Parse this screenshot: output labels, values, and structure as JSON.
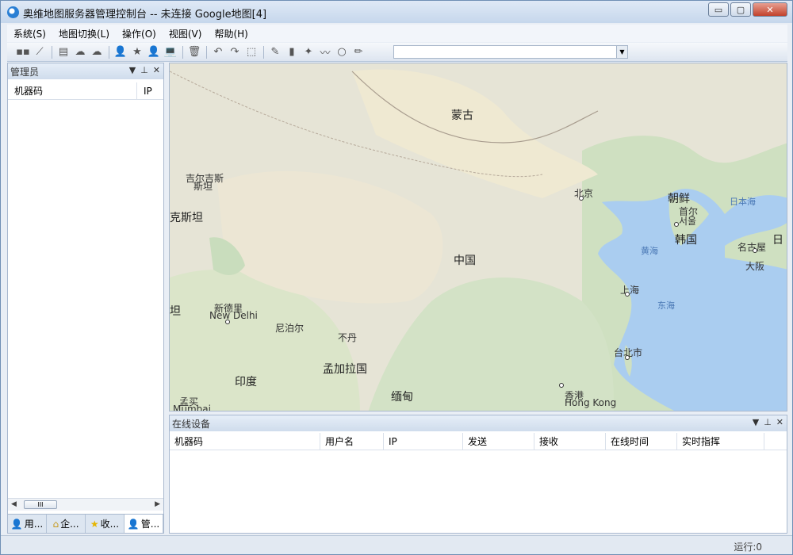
{
  "window": {
    "title": "奥维地图服务器管理控制台 -- 未连接  Google地图[4]",
    "minimize_label": "▭",
    "maximize_label": "▢",
    "close_label": "✕"
  },
  "menu": [
    {
      "label": "系统(S)"
    },
    {
      "label": "地图切换(L)"
    },
    {
      "label": "操作(O)"
    },
    {
      "label": "视图(V)"
    },
    {
      "label": "帮助(H)"
    }
  ],
  "toolbar": {
    "buttons": [
      {
        "name": "connect-icon",
        "glyph": "▪▪"
      },
      {
        "name": "disconnect-icon",
        "glyph": "⟋"
      },
      {
        "name": "document-icon",
        "glyph": "▤"
      },
      {
        "name": "cloud-sync-icon",
        "glyph": "☁"
      },
      {
        "name": "cloud-icon",
        "glyph": "☁"
      },
      {
        "name": "users-icon",
        "glyph": "👤"
      },
      {
        "name": "star-icon",
        "glyph": "★"
      },
      {
        "name": "user-icon",
        "glyph": "👤"
      },
      {
        "name": "laptop-icon",
        "glyph": "💻"
      },
      {
        "name": "delete-icon",
        "glyph": "🗑"
      },
      {
        "name": "undo-icon",
        "glyph": "↶"
      },
      {
        "name": "redo-icon",
        "glyph": "↷"
      },
      {
        "name": "select-rect-icon",
        "glyph": "⬚"
      },
      {
        "name": "pen-icon",
        "glyph": "✎"
      },
      {
        "name": "ruler-icon",
        "glyph": "▮"
      },
      {
        "name": "star-add-icon",
        "glyph": "✦"
      },
      {
        "name": "path-icon",
        "glyph": "〰"
      },
      {
        "name": "circle-icon",
        "glyph": "○"
      },
      {
        "name": "edit-icon",
        "glyph": "✏"
      }
    ],
    "combo_value": ""
  },
  "left_panel": {
    "title": "管理员",
    "columns": [
      "机器码",
      "IP"
    ],
    "tabs": [
      {
        "label": "用...",
        "icon": "users-icon"
      },
      {
        "label": "企...",
        "icon": "enterprise-icon"
      },
      {
        "label": "收...",
        "icon": "star-icon"
      },
      {
        "label": "管...",
        "icon": "admin-icon"
      }
    ],
    "scroll_thumb": "III"
  },
  "map": {
    "labels": [
      {
        "text": "蒙古",
        "kind": "big"
      },
      {
        "text": "中国",
        "kind": "big"
      },
      {
        "text": "北京",
        "kind": "city"
      },
      {
        "text": "朝鲜",
        "kind": "big"
      },
      {
        "text": "首尔",
        "kind": "city"
      },
      {
        "text": "서울",
        "kind": "city"
      },
      {
        "text": "韩国",
        "kind": "big"
      },
      {
        "text": "日本海",
        "kind": "sea"
      },
      {
        "text": "黄海",
        "kind": "sea"
      },
      {
        "text": "东海",
        "kind": "sea"
      },
      {
        "text": "名古屋",
        "kind": "city"
      },
      {
        "text": "大阪",
        "kind": "city"
      },
      {
        "text": "日",
        "kind": "big"
      },
      {
        "text": "上海",
        "kind": "city"
      },
      {
        "text": "台北市",
        "kind": "city"
      },
      {
        "text": "香港",
        "kind": "city"
      },
      {
        "text": "Hong Kong",
        "kind": "city"
      },
      {
        "text": "吉尔吉斯",
        "kind": "city"
      },
      {
        "text": "斯坦",
        "kind": "city"
      },
      {
        "text": "克斯坦",
        "kind": "big"
      },
      {
        "text": "坦",
        "kind": "big"
      },
      {
        "text": "新德里",
        "kind": "city"
      },
      {
        "text": "New Delhi",
        "kind": "city"
      },
      {
        "text": "尼泊尔",
        "kind": "city"
      },
      {
        "text": "不丹",
        "kind": "city"
      },
      {
        "text": "孟加拉国",
        "kind": "big"
      },
      {
        "text": "印度",
        "kind": "big"
      },
      {
        "text": "缅甸",
        "kind": "big"
      },
      {
        "text": "孟买",
        "kind": "city"
      },
      {
        "text": "Mumbai",
        "kind": "city"
      }
    ]
  },
  "bottom_panel": {
    "title": "在线设备",
    "columns": [
      "机器码",
      "用户名",
      "IP",
      "发送",
      "接收",
      "在线时间",
      "实时指挥"
    ]
  },
  "statusbar": {
    "text": "运行:0"
  },
  "colors": {
    "land": "#e8e6d9",
    "forest": "#cfe0c1",
    "sea": "#aacdf0",
    "desert": "#f1ecd9"
  }
}
